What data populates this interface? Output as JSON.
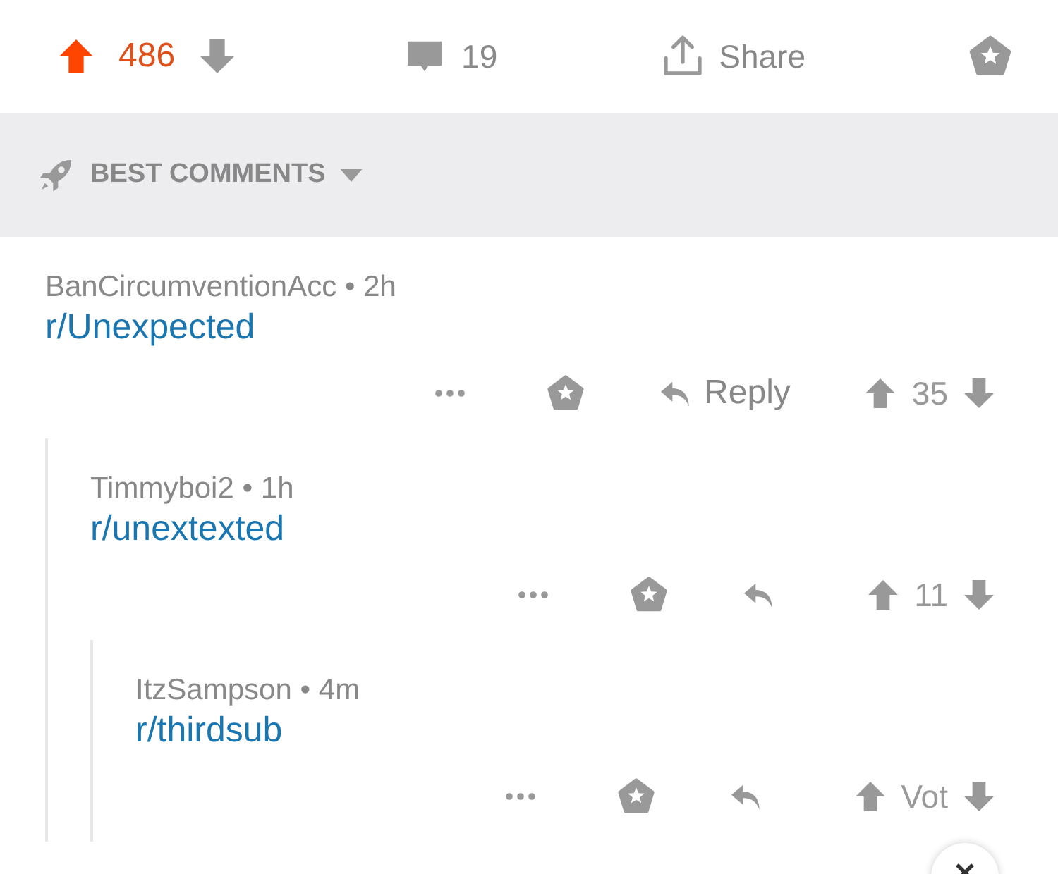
{
  "post_bar": {
    "upvoted": true,
    "score": "486",
    "comments": "19",
    "share": "Share"
  },
  "sort": {
    "label": "BEST COMMENTS"
  },
  "comments": [
    {
      "byline": "BanCircumventionAcc • 2h",
      "body": "r/Unexpected",
      "reply_label": "Reply",
      "score": "35",
      "upvoted": false,
      "children": [
        {
          "byline": "Timmyboi2 • 1h",
          "body": "r/unextexted",
          "score": "11",
          "upvoted": false,
          "children": [
            {
              "byline": "ItzSampson • 4m",
              "body": "r/thirdsub",
              "score": "Vot",
              "upvoted": false
            }
          ]
        }
      ]
    }
  ]
}
